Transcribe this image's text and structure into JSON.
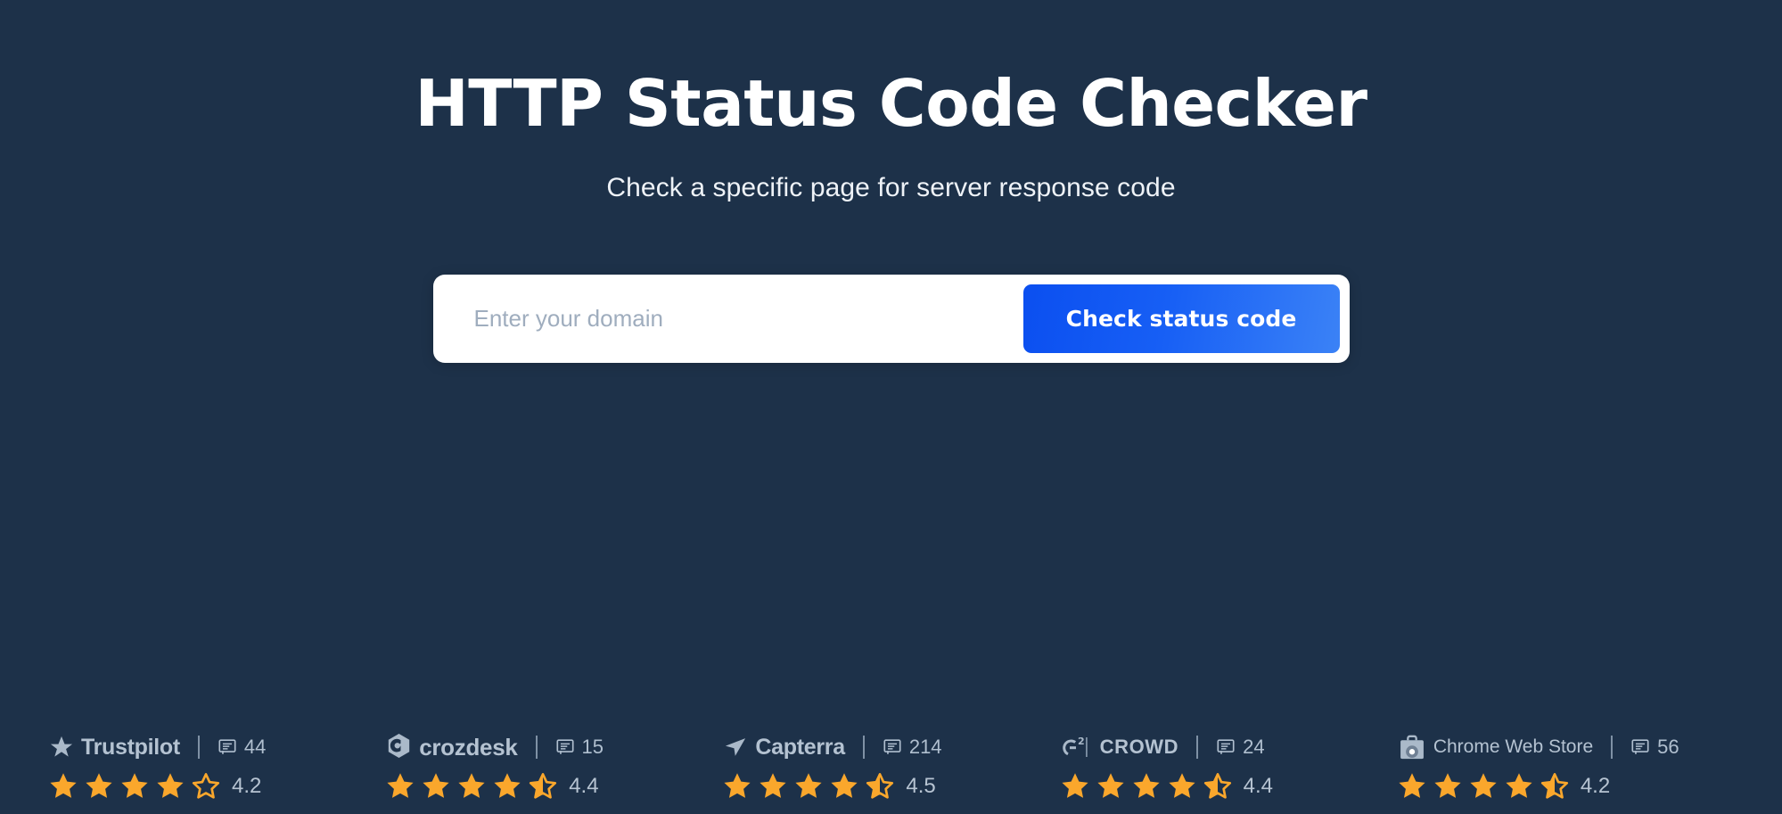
{
  "hero": {
    "title": "HTTP Status Code Checker",
    "subtitle": "Check a specific page for server response code"
  },
  "search": {
    "placeholder": "Enter your domain",
    "value": "",
    "button_label": "Check status code"
  },
  "colors": {
    "background": "#1d3149",
    "button_gradient_start": "#0b4ff0",
    "button_gradient_end": "#3b82f6",
    "star_filled": "#faa72c",
    "text_muted": "#b0bfcf",
    "card_background": "#ffffff"
  },
  "badges": [
    {
      "id": "trustpilot",
      "name": "Trustpilot",
      "icon": "trustpilot-star-icon",
      "reviews_icon": "comment-icon",
      "reviews": "44",
      "rating": "4.2",
      "stars_full": 4,
      "stars_half": 0,
      "stars_empty": 1
    },
    {
      "id": "crozdesk",
      "name": "crozdesk",
      "icon": "crozdesk-hexagon-icon",
      "reviews_icon": "comment-icon",
      "reviews": "15",
      "rating": "4.4",
      "stars_full": 4,
      "stars_half": 1,
      "stars_empty": 0
    },
    {
      "id": "capterra",
      "name": "Capterra",
      "icon": "capterra-arrow-icon",
      "reviews_icon": "comment-icon",
      "reviews": "214",
      "rating": "4.5",
      "stars_full": 4,
      "stars_half": 1,
      "stars_empty": 0
    },
    {
      "id": "g2crowd",
      "name": "CROWD",
      "icon": "g2-logo-icon",
      "reviews_icon": "comment-icon",
      "reviews": "24",
      "rating": "4.4",
      "stars_full": 4,
      "stars_half": 1,
      "stars_empty": 0
    },
    {
      "id": "chrome-web-store",
      "name": "Chrome Web Store",
      "icon": "chrome-web-store-bag-icon",
      "reviews_icon": "comment-icon",
      "reviews": "56",
      "rating": "4.2",
      "stars_full": 4,
      "stars_half": 1,
      "stars_empty": 0
    }
  ]
}
